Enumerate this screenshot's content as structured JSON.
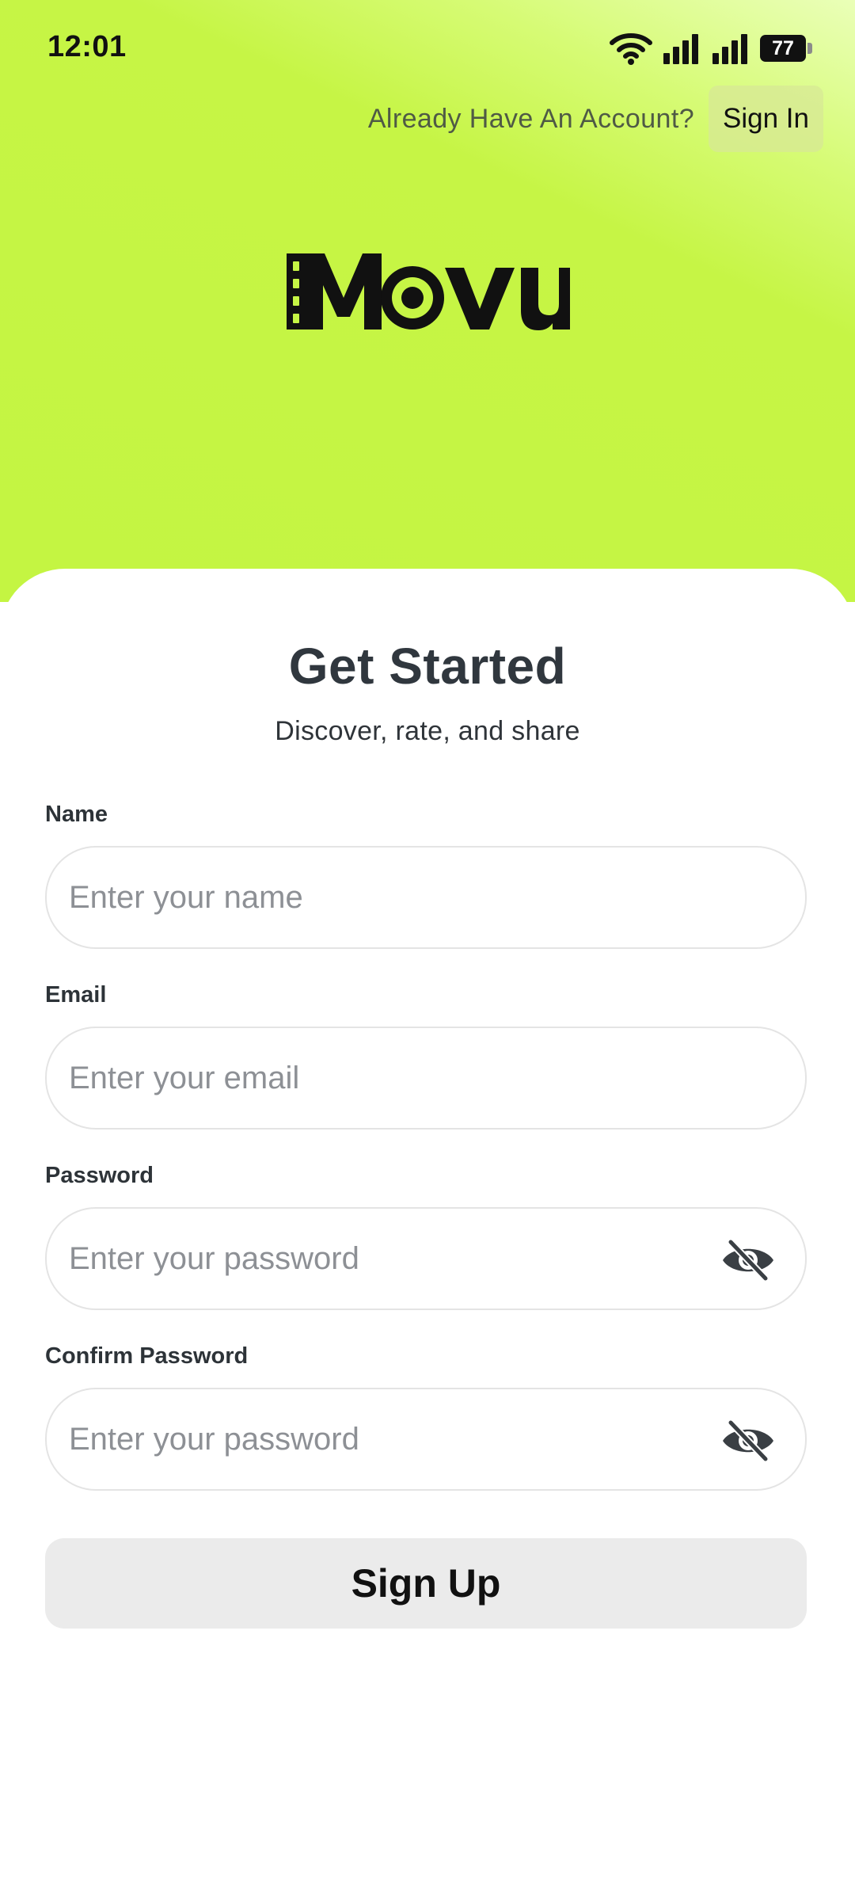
{
  "status_bar": {
    "time": "12:01",
    "battery": "77",
    "icons": [
      "wifi-icon",
      "signal-icon",
      "signal-icon",
      "battery-icon"
    ]
  },
  "header": {
    "account_prompt": "Already Have An Account?",
    "sign_in_label": "Sign In"
  },
  "brand": {
    "logo_text": "Movu",
    "accent_color": "#c6f545",
    "text_color": "#111111"
  },
  "form": {
    "title": "Get Started",
    "subtitle": "Discover, rate, and share",
    "fields": [
      {
        "label": "Name",
        "placeholder": "Enter your name",
        "value": ""
      },
      {
        "label": "Email",
        "placeholder": "Enter your email",
        "value": ""
      },
      {
        "label": "Password",
        "placeholder": "Enter your password",
        "value": "",
        "icon": "eye-off-icon"
      },
      {
        "label": "Confirm Password",
        "placeholder": "Enter your password",
        "value": "",
        "icon": "eye-off-icon"
      }
    ],
    "submit_label": "Sign Up"
  }
}
